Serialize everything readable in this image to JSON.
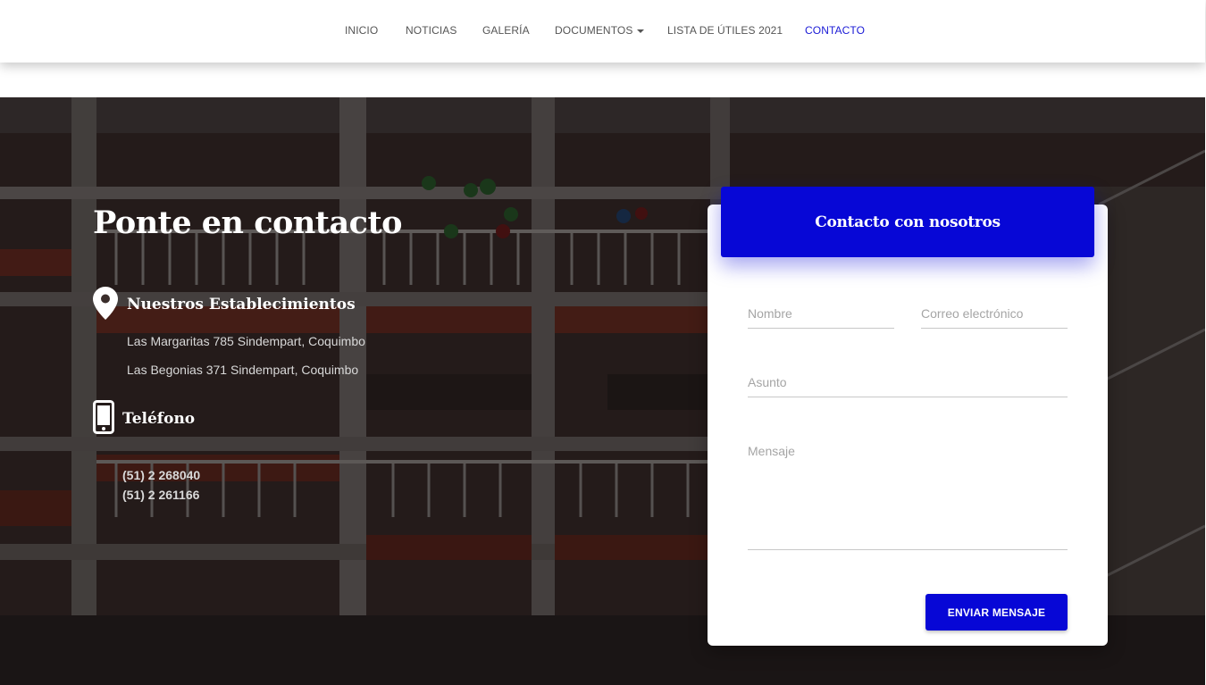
{
  "nav": {
    "items": [
      {
        "label": "INICIO"
      },
      {
        "label": "NOTICIAS"
      },
      {
        "label": "GALERÍA"
      },
      {
        "label": "DOCUMENTOS"
      },
      {
        "label": "LISTA DE ÚTILES 2021"
      },
      {
        "label": "CONTACTO"
      }
    ],
    "active": "CONTACTO",
    "active_color": "#1a1ad6",
    "dropdown_item": "DOCUMENTOS"
  },
  "contact": {
    "title": "Ponte en contacto",
    "locations": {
      "heading": "Nuestros Establecimientos",
      "icon": "map-marker-icon",
      "addresses": [
        "Las Margaritas 785 Sindempart, Coquimbo",
        "Las Begonias 371 Sindempart, Coquimbo"
      ]
    },
    "phone": {
      "heading": "Teléfono",
      "icon": "smartphone-icon",
      "numbers": [
        "(51) 2 268040",
        "(51) 2 261166"
      ]
    }
  },
  "form": {
    "header": "Contacto con nosotros",
    "name_placeholder": "Nombre",
    "email_placeholder": "Correo electrónico",
    "subject_placeholder": "Asunto",
    "message_placeholder": "Mensaje",
    "submit_label": "ENVIAR MENSAJE",
    "accent_color": "#0707d6"
  }
}
